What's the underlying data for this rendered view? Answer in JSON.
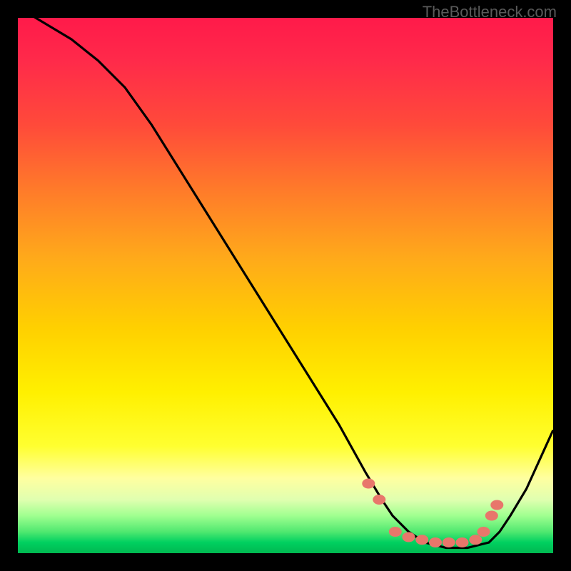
{
  "watermark": "TheBottleneck.com",
  "chart_data": {
    "type": "line",
    "title": "",
    "xlabel": "",
    "ylabel": "",
    "xlim": [
      0,
      100
    ],
    "ylim": [
      0,
      100
    ],
    "series": [
      {
        "name": "bottleneck-curve",
        "x": [
          0,
          5,
          10,
          15,
          20,
          25,
          30,
          35,
          40,
          45,
          50,
          55,
          60,
          65,
          68,
          70,
          73,
          76,
          80,
          84,
          88,
          90,
          92,
          95,
          100
        ],
        "y": [
          102,
          99,
          96,
          92,
          87,
          80,
          72,
          64,
          56,
          48,
          40,
          32,
          24,
          15,
          10,
          7,
          4,
          2,
          1,
          1,
          2,
          4,
          7,
          12,
          23
        ]
      }
    ],
    "markers": {
      "name": "optimal-zone-dots",
      "x": [
        65.5,
        67.5,
        70.5,
        73,
        75.5,
        78,
        80.5,
        83,
        85.5,
        87,
        88.5,
        89.5
      ],
      "y": [
        13,
        10,
        4,
        3,
        2.5,
        2,
        2,
        2,
        2.5,
        4,
        7,
        9
      ]
    },
    "gradient_stops": [
      {
        "pos": 0,
        "color": "#ff1a4a"
      },
      {
        "pos": 20,
        "color": "#ff4a3a"
      },
      {
        "pos": 45,
        "color": "#ffaa1a"
      },
      {
        "pos": 70,
        "color": "#fff000"
      },
      {
        "pos": 90,
        "color": "#e0ffb0"
      },
      {
        "pos": 100,
        "color": "#00b850"
      }
    ],
    "marker_color": "#e8766b"
  }
}
